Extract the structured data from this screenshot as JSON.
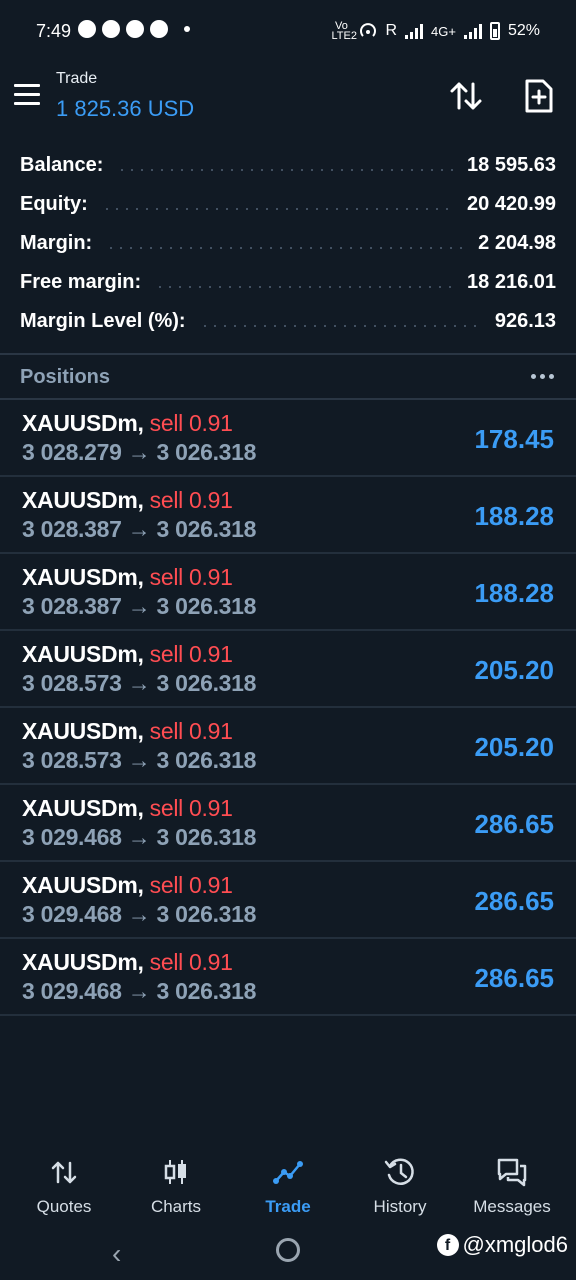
{
  "status_bar": {
    "time": "7:49",
    "network": "4G+",
    "roaming": "R",
    "volte": "Vo LTE2",
    "battery": "52%"
  },
  "header": {
    "title": "Trade",
    "balance": "1 825.36 USD"
  },
  "summary": [
    {
      "label": "Balance:",
      "value": "18 595.63"
    },
    {
      "label": "Equity:",
      "value": "20 420.99"
    },
    {
      "label": "Margin:",
      "value": "2 204.98"
    },
    {
      "label": "Free margin:",
      "value": "18 216.01"
    },
    {
      "label": "Margin Level (%):",
      "value": "926.13"
    }
  ],
  "positions": {
    "title": "Positions",
    "items": [
      {
        "symbol": "XAUUSDm,",
        "side": "sell 0.91",
        "open": "3 028.279",
        "arrow": "→",
        "current": "3 026.318",
        "profit": "178.45"
      },
      {
        "symbol": "XAUUSDm,",
        "side": "sell 0.91",
        "open": "3 028.387",
        "arrow": "→",
        "current": "3 026.318",
        "profit": "188.28"
      },
      {
        "symbol": "XAUUSDm,",
        "side": "sell 0.91",
        "open": "3 028.387",
        "arrow": "→",
        "current": "3 026.318",
        "profit": "188.28"
      },
      {
        "symbol": "XAUUSDm,",
        "side": "sell 0.91",
        "open": "3 028.573",
        "arrow": "→",
        "current": "3 026.318",
        "profit": "205.20"
      },
      {
        "symbol": "XAUUSDm,",
        "side": "sell 0.91",
        "open": "3 028.573",
        "arrow": "→",
        "current": "3 026.318",
        "profit": "205.20"
      },
      {
        "symbol": "XAUUSDm,",
        "side": "sell 0.91",
        "open": "3 029.468",
        "arrow": "→",
        "current": "3 026.318",
        "profit": "286.65"
      },
      {
        "symbol": "XAUUSDm,",
        "side": "sell 0.91",
        "open": "3 029.468",
        "arrow": "→",
        "current": "3 026.318",
        "profit": "286.65"
      },
      {
        "symbol": "XAUUSDm,",
        "side": "sell 0.91",
        "open": "3 029.468",
        "arrow": "→",
        "current": "3 026.318",
        "profit": "286.65"
      }
    ]
  },
  "bottom_nav": [
    {
      "label": "Quotes",
      "icon": "quotes-icon"
    },
    {
      "label": "Charts",
      "icon": "candlestick-icon"
    },
    {
      "label": "Trade",
      "icon": "trend-line-icon",
      "active": true
    },
    {
      "label": "History",
      "icon": "history-icon"
    },
    {
      "label": "Messages",
      "icon": "chat-bubbles-icon"
    }
  ],
  "watermark": "@xmglod6",
  "colors": {
    "background": "#111a24",
    "accent": "#3b9cf5",
    "sell": "#ff4d52",
    "muted": "#8ea2b6"
  }
}
